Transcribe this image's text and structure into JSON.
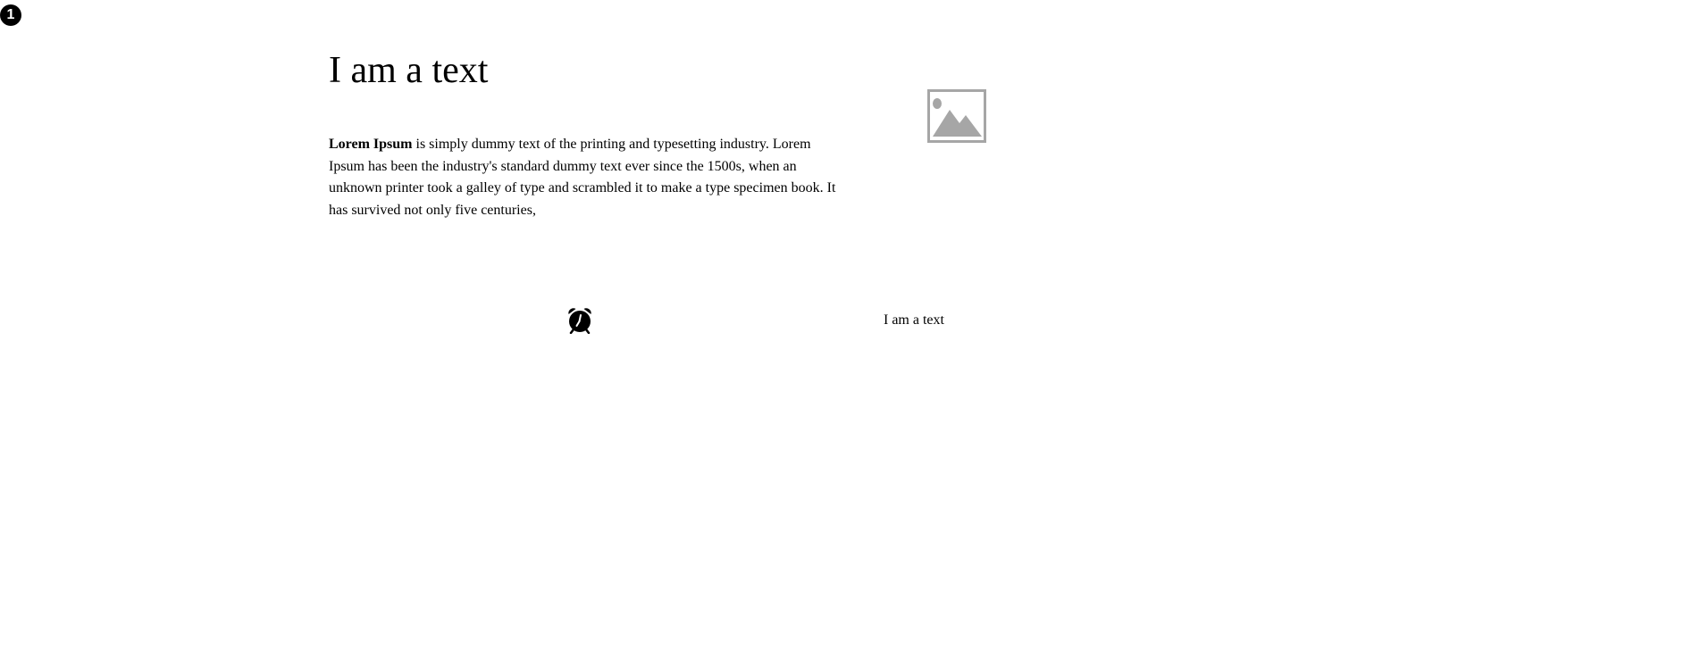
{
  "step_badge": {
    "label": "1"
  },
  "heading": {
    "text": "I am a text"
  },
  "paragraph": {
    "bold": "Lorem Ipsum",
    "rest": " is simply dummy text of the printing and typesetting industry. Lorem Ipsum has been the industry's standard dummy text ever since the 1500s, when an unknown printer took a galley of type and scrambled it to make a type specimen book. It has survived not only five centuries,"
  },
  "image": {
    "icon": "image-placeholder-icon",
    "color": "#a6a6a6"
  },
  "alarm": {
    "icon": "alarm-clock-icon"
  },
  "caption": {
    "text": "I am a text"
  }
}
